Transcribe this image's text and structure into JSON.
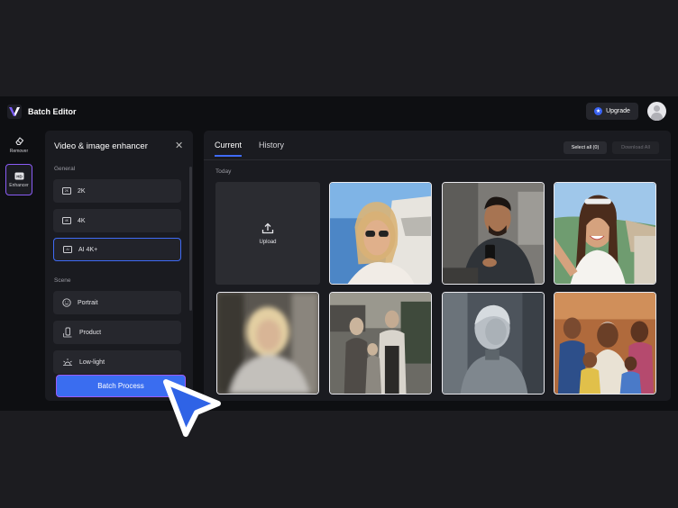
{
  "app": {
    "title": "Batch Editor",
    "upgrade_label": "Upgrade"
  },
  "rail": {
    "items": [
      {
        "label": "Remover"
      },
      {
        "label": "Enhancer"
      }
    ]
  },
  "panel": {
    "title": "Video & image enhancer",
    "general_label": "General",
    "general_options": [
      {
        "label": "2K",
        "icon": "2k-icon"
      },
      {
        "label": "4K",
        "icon": "4k-icon"
      },
      {
        "label": "AI 4K+",
        "icon": "ai-4k-icon",
        "selected": true
      }
    ],
    "scene_label": "Scene",
    "scene_options": [
      {
        "label": "Portrait",
        "icon": "smile-icon"
      },
      {
        "label": "Product",
        "icon": "product-icon"
      },
      {
        "label": "Low-light",
        "icon": "sun-icon"
      }
    ],
    "batch_button": "Batch Process"
  },
  "main": {
    "tabs": [
      {
        "label": "Current",
        "active": true
      },
      {
        "label": "History"
      }
    ],
    "select_all": "Select all (0)",
    "download_all": "Download All",
    "date_group": "Today",
    "upload_label": "Upload"
  },
  "colors": {
    "accent": "#3a6df0",
    "enhancer_border": "#8a5cf6",
    "background": "#0e0f12"
  }
}
